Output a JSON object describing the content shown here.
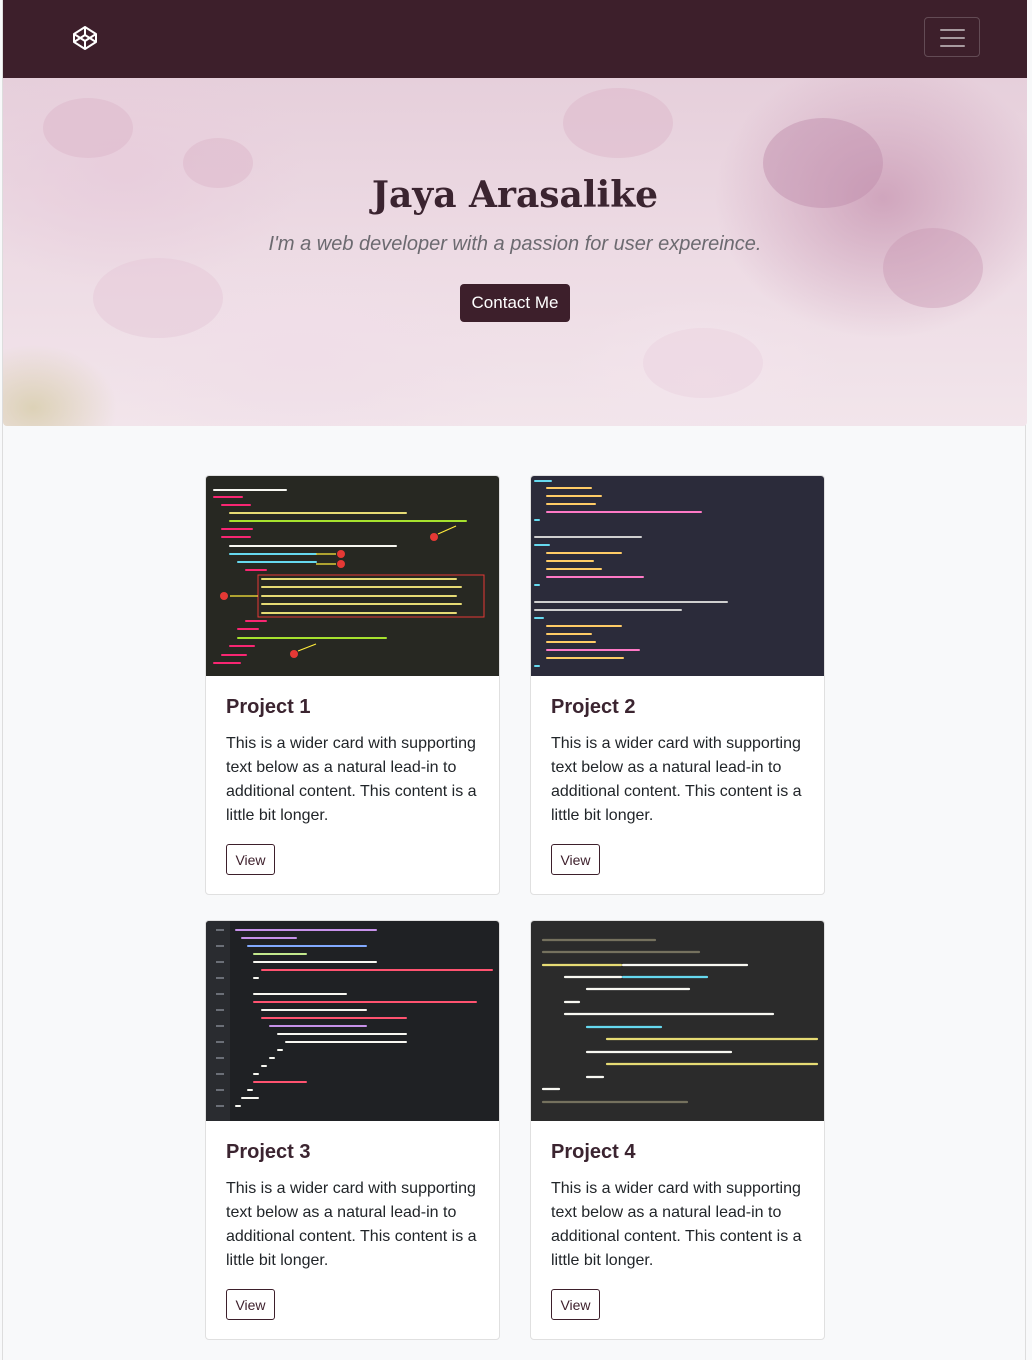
{
  "navbar": {
    "logo_icon": "codepen-logo-icon",
    "toggler_icon": "hamburger-menu-icon",
    "background": "#3d1f2b"
  },
  "hero": {
    "title": "Jaya Arasalike",
    "subtitle": "I'm a web developer with a passion for user expereince.",
    "contact_label": "Contact Me"
  },
  "cards": [
    {
      "title": "Project 1",
      "text": "This is a wider card with supporting text below as a natural lead-in to additional content. This content is a little bit longer.",
      "button": "View"
    },
    {
      "title": "Project 2",
      "text": "This is a wider card with supporting text below as a natural lead-in to additional content. This content is a little bit longer.",
      "button": "View"
    },
    {
      "title": "Project 3",
      "text": "This is a wider card with supporting text below as a natural lead-in to additional content. This content is a little bit longer.",
      "button": "View"
    },
    {
      "title": "Project 4",
      "text": "This is a wider card with supporting text below as a natural lead-in to additional content. This content is a little bit longer.",
      "button": "View"
    }
  ],
  "colors": {
    "brand": "#3d1f2b",
    "page_bg": "#f8f9fa",
    "code_bg": "#272822"
  }
}
